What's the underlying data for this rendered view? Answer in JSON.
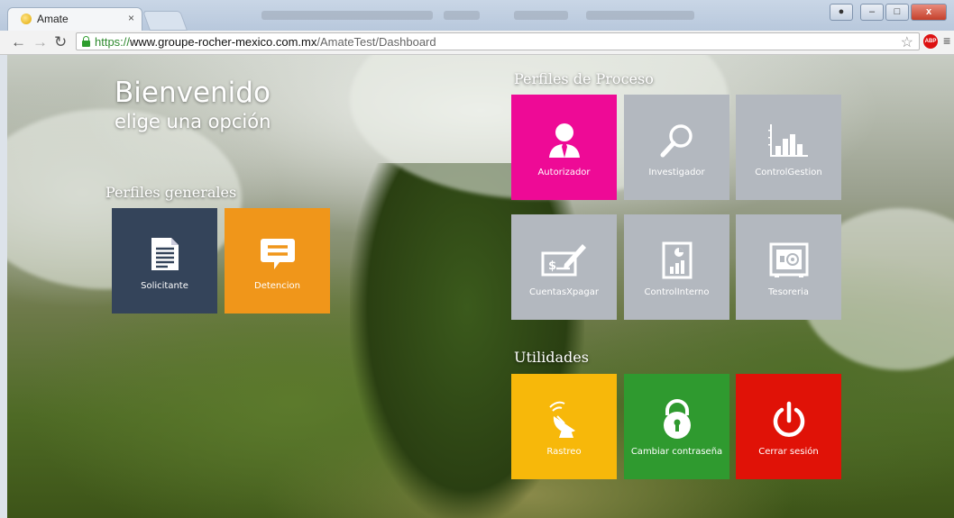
{
  "browser": {
    "tab_title": "Amate",
    "tab_close": "×",
    "url_scheme": "https://",
    "url_host": "www.groupe-rocher-mexico.com.mx",
    "url_path": "/AmateTest/Dashboard",
    "abp_label": "ABP",
    "window_minimize": "–",
    "window_maximize": "□",
    "window_close": "x"
  },
  "page": {
    "welcome_title": "Bienvenido",
    "welcome_subtitle": "elige una opción"
  },
  "perfiles_generales": {
    "heading": "Perfiles generales",
    "tiles": [
      {
        "label": "Solicitante",
        "icon": "document-icon",
        "color": "#34445a"
      },
      {
        "label": "Detencion",
        "icon": "chat-bubble-icon",
        "color": "#f0961a"
      }
    ]
  },
  "perfiles_proceso": {
    "heading": "Perfiles de Proceso",
    "tiles": [
      {
        "label": "Autorizador",
        "icon": "person-icon",
        "color": "#ee0a96"
      },
      {
        "label": "Investigador",
        "icon": "magnifier-icon",
        "color": "#b3b8bf"
      },
      {
        "label": "ControlGestion",
        "icon": "bar-chart-icon",
        "color": "#b3b8bf"
      },
      {
        "label": "CuentasXpagar",
        "icon": "check-signature-icon",
        "color": "#b3b8bf"
      },
      {
        "label": "ControlInterno",
        "icon": "report-chart-icon",
        "color": "#b3b8bf"
      },
      {
        "label": "Tesoreria",
        "icon": "safe-icon",
        "color": "#b3b8bf"
      }
    ]
  },
  "utilidades": {
    "heading": "Utilidades",
    "tiles": [
      {
        "label": "Rastreo",
        "icon": "satellite-dish-icon",
        "color": "#f7b80a"
      },
      {
        "label": "Cambiar contraseña",
        "icon": "padlock-icon",
        "color": "#2f9a2f"
      },
      {
        "label": "Cerrar sesión",
        "icon": "power-icon",
        "color": "#e01207"
      }
    ]
  }
}
